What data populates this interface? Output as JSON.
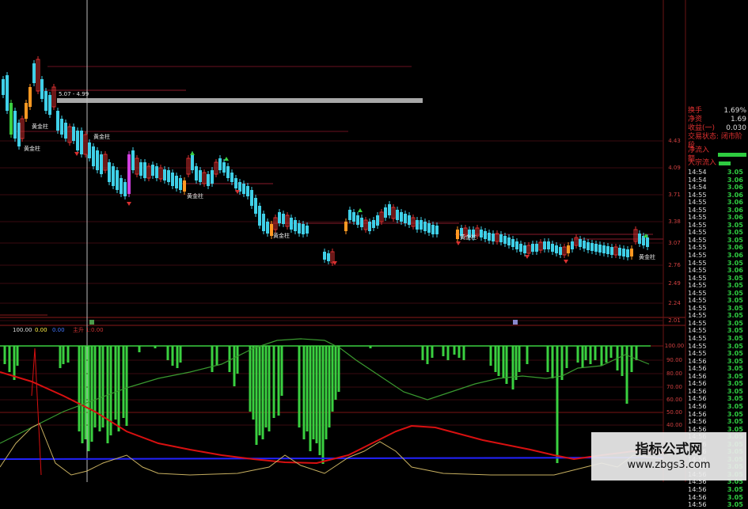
{
  "colors": {
    "up": "#d83030",
    "down": "#3fd0e8",
    "highlight": "#d040e0",
    "orange": "#ff9922",
    "bar_green": "#3ad040",
    "ma_green": "#3a9a30",
    "ma_red": "#d81010",
    "ma_blue": "#2020ff",
    "ma_yellow": "#c8b060"
  },
  "price_axis": [
    "4.43",
    "4.09",
    "3.71",
    "3.38",
    "3.07",
    "2.76",
    "2.49",
    "2.24",
    "2.01"
  ],
  "indicator_axis": [
    "100.00",
    "90.00",
    "80.00",
    "70.00",
    "60.00",
    "50.00",
    "40.00"
  ],
  "indicator_header": {
    "items": [
      "100.00",
      "0.00",
      "0.00",
      "主升 1:0.00"
    ]
  },
  "crosshair_label": "5.07 - 4.99",
  "signal_label": "黄金柱",
  "side_panel": {
    "rows": [
      {
        "label": "换手",
        "value": "1.69%"
      },
      {
        "label": "净资",
        "value": "1.69"
      },
      {
        "label": "收益(一)",
        "value": "0.030"
      }
    ],
    "status": "交易状态: 闭市阶段",
    "flows": [
      {
        "label": "净流入额",
        "fill": 0.92
      },
      {
        "label": "大宗流入",
        "fill": 0.38
      }
    ],
    "ticks": [
      {
        "time": "14:54",
        "price": "3.05"
      },
      {
        "time": "14:54",
        "price": "3.06"
      },
      {
        "time": "14:54",
        "price": "3.06"
      },
      {
        "time": "14:55",
        "price": "3.06"
      },
      {
        "time": "14:55",
        "price": "3.06"
      },
      {
        "time": "14:55",
        "price": "3.06"
      },
      {
        "time": "14:55",
        "price": "3.06"
      },
      {
        "time": "14:55",
        "price": "3.05"
      },
      {
        "time": "14:55",
        "price": "3.05"
      },
      {
        "time": "14:55",
        "price": "3.05"
      },
      {
        "time": "14:55",
        "price": "3.06"
      },
      {
        "time": "14:55",
        "price": "3.06"
      },
      {
        "time": "14:55",
        "price": "3.05"
      },
      {
        "time": "14:55",
        "price": "3.06"
      },
      {
        "time": "14:55",
        "price": "3.05"
      },
      {
        "time": "14:55",
        "price": "3.05"
      },
      {
        "time": "14:55",
        "price": "3.05"
      },
      {
        "time": "14:55",
        "price": "3.05"
      },
      {
        "time": "14:55",
        "price": "3.05"
      },
      {
        "time": "14:55",
        "price": "3.05"
      },
      {
        "time": "14:55",
        "price": "3.05"
      },
      {
        "time": "14:55",
        "price": "3.05"
      },
      {
        "time": "14:55",
        "price": "3.05"
      },
      {
        "time": "14:55",
        "price": "3.05"
      },
      {
        "time": "14:55",
        "price": "3.05"
      },
      {
        "time": "14:56",
        "price": "3.05"
      },
      {
        "time": "14:56",
        "price": "3.05"
      },
      {
        "time": "14:56",
        "price": "3.05"
      },
      {
        "time": "14:56",
        "price": "3.05"
      },
      {
        "time": "14:56",
        "price": "3.05"
      },
      {
        "time": "14:56",
        "price": "3.05"
      },
      {
        "time": "14:56",
        "price": "3.05"
      },
      {
        "time": "14:56",
        "price": "3.05"
      },
      {
        "time": "14:56",
        "price": "3.05"
      },
      {
        "time": "14:56",
        "price": "3.05"
      },
      {
        "time": "14:56",
        "price": "3.05"
      },
      {
        "time": "14:56",
        "price": "3.05"
      },
      {
        "time": "14:56",
        "price": "3.05"
      },
      {
        "time": "14:56",
        "price": "3.05"
      },
      {
        "time": "14:56",
        "price": "3.05"
      },
      {
        "time": "14:56",
        "price": "3.05"
      },
      {
        "time": "14:56",
        "price": "3.05"
      },
      {
        "time": "14:56",
        "price": "3.05"
      },
      {
        "time": "14:56",
        "price": "3.05"
      },
      {
        "time": "14:56",
        "price": "3.05"
      }
    ]
  },
  "watermark": {
    "title": "指标公式网",
    "url": "www.zbgs3.com"
  }
}
